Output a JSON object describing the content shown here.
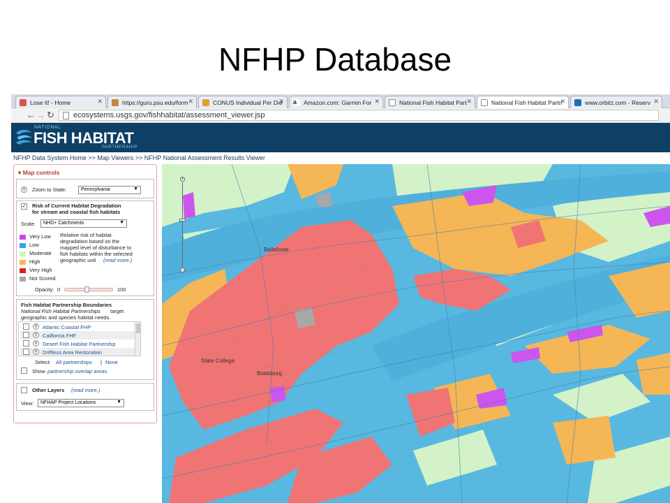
{
  "slide": {
    "title": "NFHP Database"
  },
  "browser": {
    "tabs": [
      {
        "label": "Lose It! - Home",
        "icon_color": "#d9534f"
      },
      {
        "label": "https://guru.psu.edu/form",
        "icon_color": "#c08a3e"
      },
      {
        "label": "CONUS Individual Per Die",
        "icon_color": "#e0a030"
      },
      {
        "label": "Amazon.com: Garmin For",
        "icon_color": "#222222"
      },
      {
        "label": "National Fish Habitat Part",
        "icon_color": "#ffffff"
      },
      {
        "label": "National Fish Habitat Partn",
        "icon_color": "#ffffff"
      },
      {
        "label": "www.orbitz.com - Reserv",
        "icon_color": "#1d6fb8"
      }
    ],
    "active_tab_index": 5,
    "url": "ecosystems.usgs.gov/fishhabitat/assessment_viewer.jsp",
    "back_icon": "back-arrow-icon",
    "forward_icon": "forward-arrow-icon",
    "reload_icon": "reload-icon"
  },
  "header": {
    "logo_top": "NATIONAL",
    "logo_main": "FISH HABITAT",
    "logo_bottom": "PARTNERSHIP",
    "bg_color": "#0e3f64"
  },
  "breadcrumb": "NFHP Data System Home >> Map Viewers >> NFHP National Assessment Results Viewer",
  "map_controls": {
    "title": "▾ Map controls",
    "zoom_label": "Zoom to State:",
    "zoom_value": "Pennsylvania",
    "risk_title_1": "Risk of Current Habitat Degradation",
    "risk_title_2": "for stream and coastal fish habitats",
    "scale_label": "Scale:",
    "scale_value": "NHD+ Catchments",
    "legend": [
      {
        "label": "Very Low",
        "color": "#cc44ee"
      },
      {
        "label": "Low",
        "color": "#2fa8e0"
      },
      {
        "label": "Moderate",
        "color": "#d3f2c8"
      },
      {
        "label": "High",
        "color": "#f5b656"
      },
      {
        "label": "Very High",
        "color": "#e01e1e"
      },
      {
        "label": "Not Scored",
        "color": "#a8a8a8"
      }
    ],
    "desc_1": "Relative risk of habitat",
    "desc_2": "degradation based on the",
    "desc_3": "mapped level of disturbance to",
    "desc_4": "fish habitats within the selected",
    "desc_5": "geographic unit",
    "desc_more": "(read more.)",
    "opacity_label": "Opacity:",
    "opacity_min": "0",
    "opacity_max": "100",
    "opacity_value": 0.45,
    "fhp_title": "Fish Habitat Partnership Boundaries",
    "fhp_desc_1": "National Fish Habitat Partnerships",
    "fhp_desc_1b": "target",
    "fhp_desc_2": "geographic and species habitat needs.",
    "partnerships": [
      "Atlantic Coastal FHP",
      "California FHF",
      "Desert Fish Habitat Partnership",
      "Driftless Area Restoration"
    ],
    "select_label": "Select:",
    "select_all": "All partnerships",
    "select_sep": "|",
    "select_none": "None",
    "show_label": "Show",
    "show_link": "partnership overlap areas.",
    "other_layers": "Other Layers",
    "other_more": "(read more.)",
    "view_label": "View:",
    "view_value": "NFHAP Project Locations"
  },
  "map": {
    "places": [
      "Bellefonte",
      "State College",
      "Boalsburg"
    ]
  }
}
